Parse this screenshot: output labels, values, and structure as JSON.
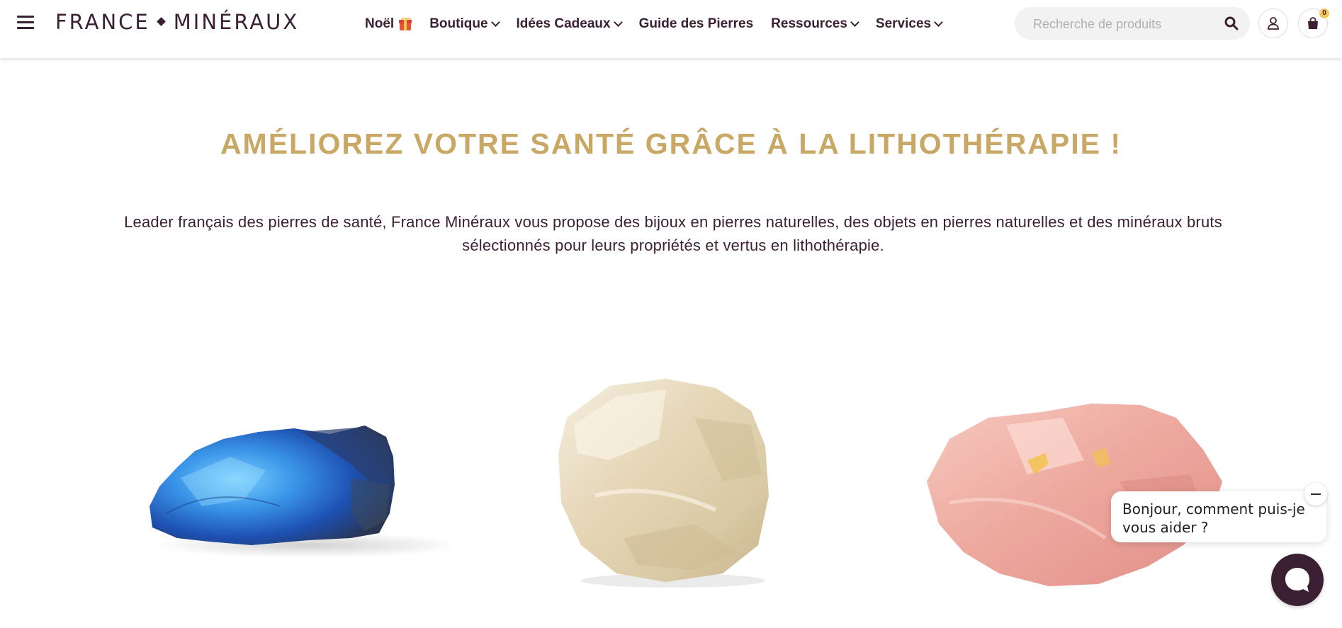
{
  "brand": {
    "name_left": "FRANCE",
    "name_right": "MINÉRAUX"
  },
  "nav": {
    "items": [
      {
        "label": "Noël",
        "has_gift_icon": true
      },
      {
        "label": "Boutique",
        "has_dropdown": true
      },
      {
        "label": "Idées Cadeaux",
        "has_dropdown": true
      },
      {
        "label": "Guide des Pierres"
      },
      {
        "label": "Ressources",
        "has_dropdown": true
      },
      {
        "label": "Services",
        "has_dropdown": true
      }
    ]
  },
  "search": {
    "placeholder": "Recherche de produits",
    "value": ""
  },
  "cart": {
    "count": "0"
  },
  "hero": {
    "title": "AMÉLIOREZ VOTRE SANTÉ GRÂCE À LA LITHOTHÉRAPIE !",
    "text": "Leader français des pierres de santé, France Minéraux vous propose des bijoux en pierres naturelles, des objets en pierres naturelles et des minéraux bruts sélectionnés pour leurs propriétés et vertus en lithothérapie."
  },
  "stones": [
    {
      "name": "labradorite-stone",
      "color": "#3a8ee6"
    },
    {
      "name": "moonstone",
      "color": "#e8dcc0"
    },
    {
      "name": "rose-quartz-stone",
      "color": "#f0b4a8"
    }
  ],
  "chat": {
    "greeting": "Bonjour, comment puis-je vous aider ?"
  },
  "colors": {
    "accent_gold": "#c9a764",
    "brand_plum": "#3b1f33",
    "badge_yellow": "#f5c85a"
  }
}
